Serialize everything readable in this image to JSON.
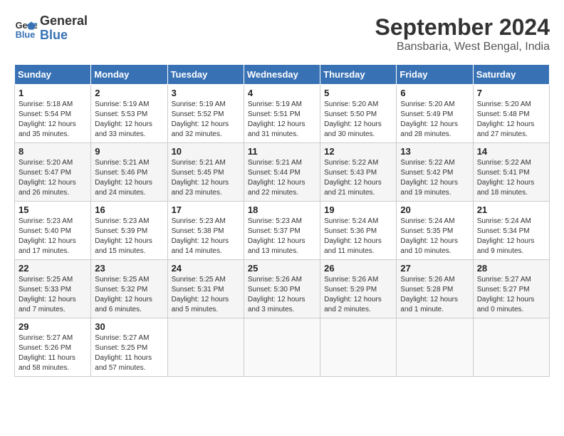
{
  "header": {
    "logo_line1": "General",
    "logo_line2": "Blue",
    "month_year": "September 2024",
    "location": "Bansbaria, West Bengal, India"
  },
  "weekdays": [
    "Sunday",
    "Monday",
    "Tuesday",
    "Wednesday",
    "Thursday",
    "Friday",
    "Saturday"
  ],
  "weeks": [
    [
      {
        "day": "1",
        "sunrise": "5:18 AM",
        "sunset": "5:54 PM",
        "daylight": "12 hours and 35 minutes."
      },
      {
        "day": "2",
        "sunrise": "5:19 AM",
        "sunset": "5:53 PM",
        "daylight": "12 hours and 33 minutes."
      },
      {
        "day": "3",
        "sunrise": "5:19 AM",
        "sunset": "5:52 PM",
        "daylight": "12 hours and 32 minutes."
      },
      {
        "day": "4",
        "sunrise": "5:19 AM",
        "sunset": "5:51 PM",
        "daylight": "12 hours and 31 minutes."
      },
      {
        "day": "5",
        "sunrise": "5:20 AM",
        "sunset": "5:50 PM",
        "daylight": "12 hours and 30 minutes."
      },
      {
        "day": "6",
        "sunrise": "5:20 AM",
        "sunset": "5:49 PM",
        "daylight": "12 hours and 28 minutes."
      },
      {
        "day": "7",
        "sunrise": "5:20 AM",
        "sunset": "5:48 PM",
        "daylight": "12 hours and 27 minutes."
      }
    ],
    [
      {
        "day": "8",
        "sunrise": "5:20 AM",
        "sunset": "5:47 PM",
        "daylight": "12 hours and 26 minutes."
      },
      {
        "day": "9",
        "sunrise": "5:21 AM",
        "sunset": "5:46 PM",
        "daylight": "12 hours and 24 minutes."
      },
      {
        "day": "10",
        "sunrise": "5:21 AM",
        "sunset": "5:45 PM",
        "daylight": "12 hours and 23 minutes."
      },
      {
        "day": "11",
        "sunrise": "5:21 AM",
        "sunset": "5:44 PM",
        "daylight": "12 hours and 22 minutes."
      },
      {
        "day": "12",
        "sunrise": "5:22 AM",
        "sunset": "5:43 PM",
        "daylight": "12 hours and 21 minutes."
      },
      {
        "day": "13",
        "sunrise": "5:22 AM",
        "sunset": "5:42 PM",
        "daylight": "12 hours and 19 minutes."
      },
      {
        "day": "14",
        "sunrise": "5:22 AM",
        "sunset": "5:41 PM",
        "daylight": "12 hours and 18 minutes."
      }
    ],
    [
      {
        "day": "15",
        "sunrise": "5:23 AM",
        "sunset": "5:40 PM",
        "daylight": "12 hours and 17 minutes."
      },
      {
        "day": "16",
        "sunrise": "5:23 AM",
        "sunset": "5:39 PM",
        "daylight": "12 hours and 15 minutes."
      },
      {
        "day": "17",
        "sunrise": "5:23 AM",
        "sunset": "5:38 PM",
        "daylight": "12 hours and 14 minutes."
      },
      {
        "day": "18",
        "sunrise": "5:23 AM",
        "sunset": "5:37 PM",
        "daylight": "12 hours and 13 minutes."
      },
      {
        "day": "19",
        "sunrise": "5:24 AM",
        "sunset": "5:36 PM",
        "daylight": "12 hours and 11 minutes."
      },
      {
        "day": "20",
        "sunrise": "5:24 AM",
        "sunset": "5:35 PM",
        "daylight": "12 hours and 10 minutes."
      },
      {
        "day": "21",
        "sunrise": "5:24 AM",
        "sunset": "5:34 PM",
        "daylight": "12 hours and 9 minutes."
      }
    ],
    [
      {
        "day": "22",
        "sunrise": "5:25 AM",
        "sunset": "5:33 PM",
        "daylight": "12 hours and 7 minutes."
      },
      {
        "day": "23",
        "sunrise": "5:25 AM",
        "sunset": "5:32 PM",
        "daylight": "12 hours and 6 minutes."
      },
      {
        "day": "24",
        "sunrise": "5:25 AM",
        "sunset": "5:31 PM",
        "daylight": "12 hours and 5 minutes."
      },
      {
        "day": "25",
        "sunrise": "5:26 AM",
        "sunset": "5:30 PM",
        "daylight": "12 hours and 3 minutes."
      },
      {
        "day": "26",
        "sunrise": "5:26 AM",
        "sunset": "5:29 PM",
        "daylight": "12 hours and 2 minutes."
      },
      {
        "day": "27",
        "sunrise": "5:26 AM",
        "sunset": "5:28 PM",
        "daylight": "12 hours and 1 minute."
      },
      {
        "day": "28",
        "sunrise": "5:27 AM",
        "sunset": "5:27 PM",
        "daylight": "12 hours and 0 minutes."
      }
    ],
    [
      {
        "day": "29",
        "sunrise": "5:27 AM",
        "sunset": "5:26 PM",
        "daylight": "11 hours and 58 minutes."
      },
      {
        "day": "30",
        "sunrise": "5:27 AM",
        "sunset": "5:25 PM",
        "daylight": "11 hours and 57 minutes."
      },
      null,
      null,
      null,
      null,
      null
    ]
  ],
  "labels": {
    "sunrise": "Sunrise:",
    "sunset": "Sunset:",
    "daylight": "Daylight hours"
  }
}
